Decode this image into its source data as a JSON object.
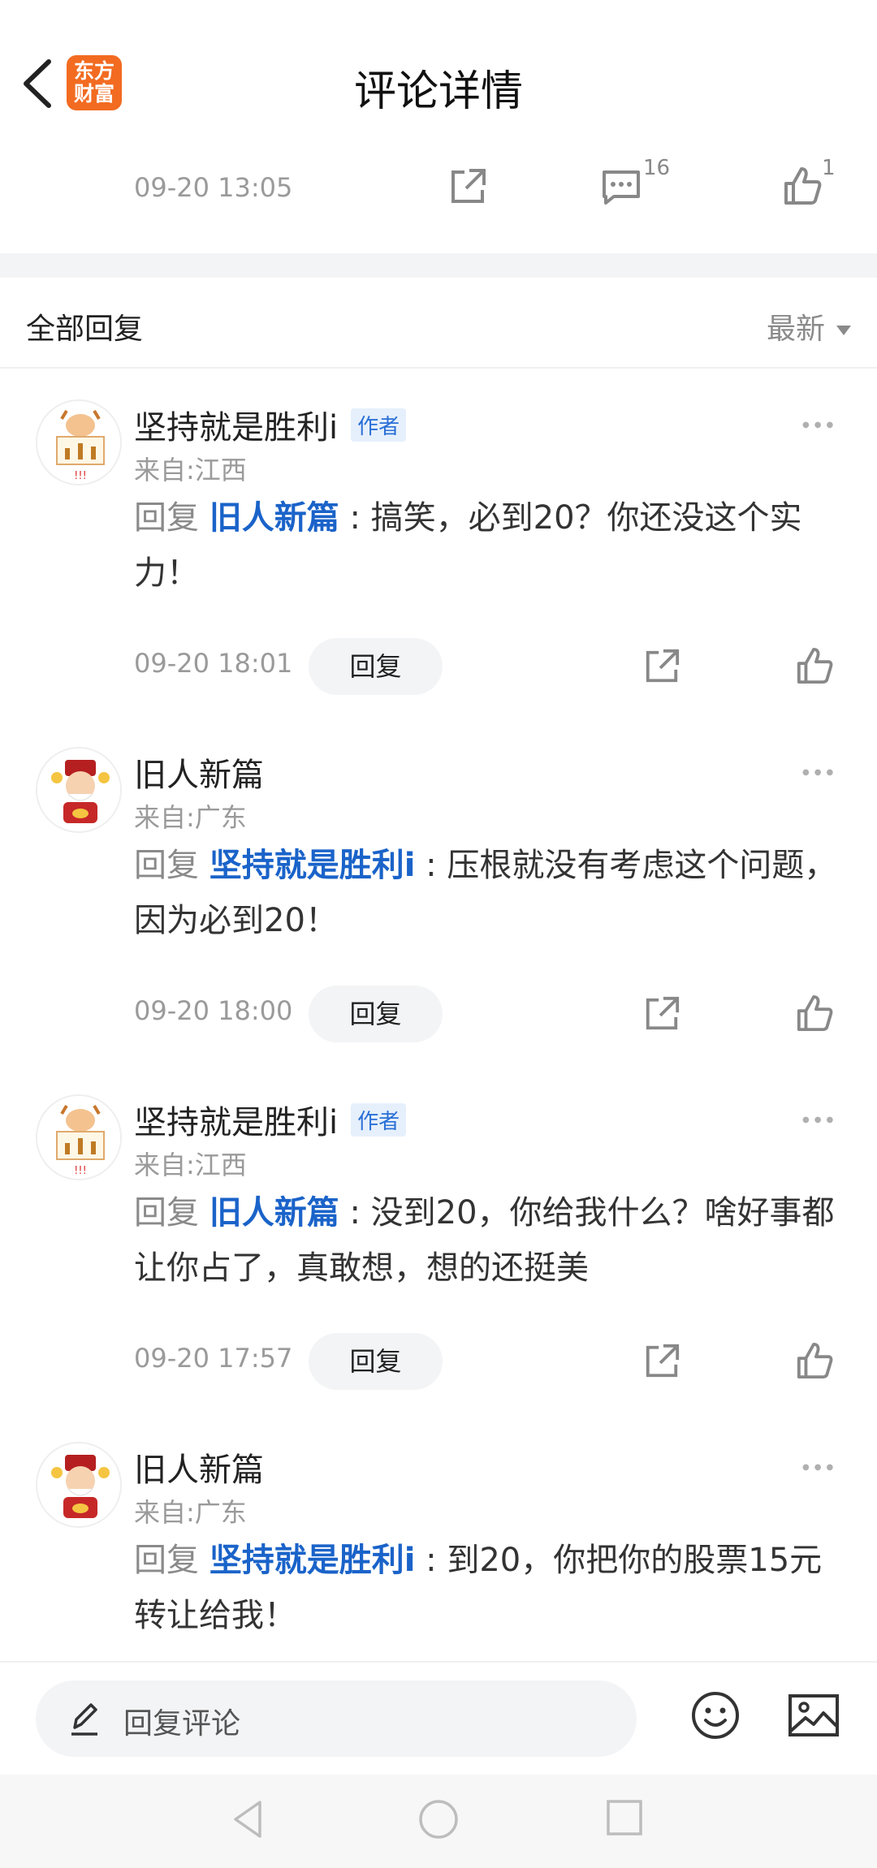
{
  "header": {
    "title": "评论详情",
    "logo_line1": "东方",
    "logo_line2": "财富"
  },
  "post_stats": {
    "date": "09-20 13:05",
    "comments": "16",
    "likes": "1"
  },
  "section": {
    "label": "全部回复",
    "sort": "最新"
  },
  "replies": [
    {
      "user": "坚持就是胜利i",
      "is_author": true,
      "badge": "作者",
      "location": "来自:江西",
      "prefix": "回复",
      "mention": "旧人新篇",
      "text": ": 搞笑，必到20？你还没这个实力！",
      "time": "09-20 18:01",
      "reply_label": "回复"
    },
    {
      "user": "旧人新篇",
      "is_author": false,
      "badge": "",
      "location": "来自:广东",
      "prefix": "回复",
      "mention": "坚持就是胜利i",
      "text": ": 压根就没有考虑这个问题，因为必到20！",
      "time": "09-20 18:00",
      "reply_label": "回复"
    },
    {
      "user": "坚持就是胜利i",
      "is_author": true,
      "badge": "作者",
      "location": "来自:江西",
      "prefix": "回复",
      "mention": "旧人新篇",
      "text": ": 没到20，你给我什么？啥好事都让你占了，真敢想，想的还挺美",
      "time": "09-20 17:57",
      "reply_label": "回复"
    },
    {
      "user": "旧人新篇",
      "is_author": false,
      "badge": "",
      "location": "来自:广东",
      "prefix": "回复",
      "mention": "坚持就是胜利i",
      "text": ": 到20，你把你的股票15元转让给我！",
      "time": "",
      "reply_label": ""
    }
  ],
  "bottom": {
    "placeholder": "回复评论"
  },
  "colors": {
    "brand": "#f26b21",
    "mention": "#1a63c9",
    "badge": "#2a6fd6"
  },
  "icons": [
    "back-arrow-icon",
    "share-icon",
    "comment-icon",
    "like-icon",
    "more-icon",
    "pen-icon",
    "emoji-icon",
    "image-icon",
    "nav-back-icon",
    "nav-home-icon",
    "nav-recent-icon"
  ]
}
